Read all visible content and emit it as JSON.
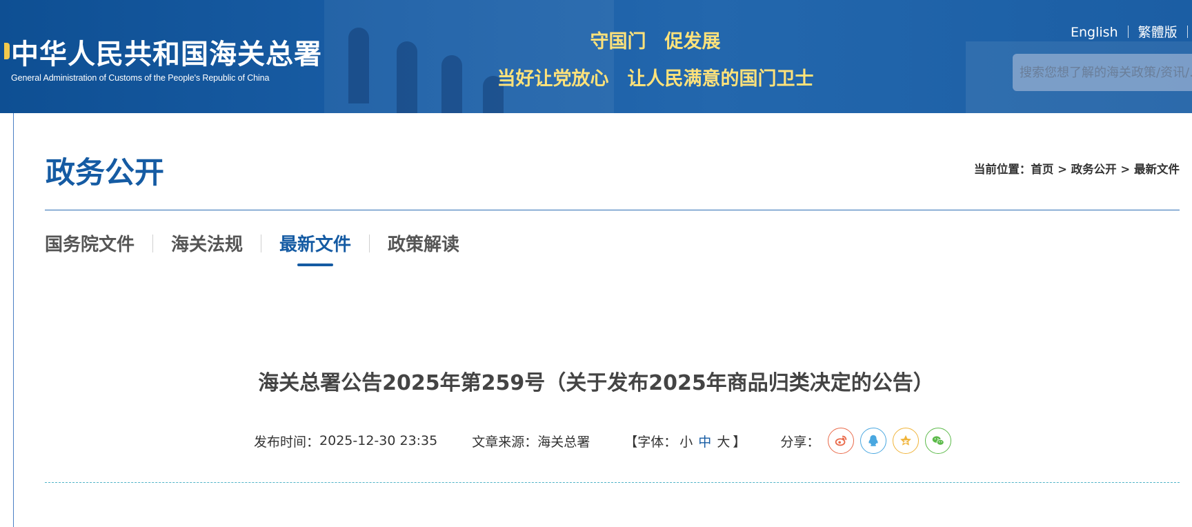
{
  "header": {
    "logo_cn": "中华人民共和国海关总署",
    "logo_en": "General Administration of Customs of the People's Republic of China",
    "slogan_line1": "守国门　促发展",
    "slogan_line2": "当好让党放心　让人民满意的国门卫士",
    "lang_english": "English",
    "lang_traditional": "繁體版",
    "search_placeholder": "搜索您想了解的海关政策/资讯/..."
  },
  "section": {
    "title": "政务公开",
    "breadcrumb_prefix": "当前位置：",
    "breadcrumb": [
      "首页",
      "政务公开",
      "最新文件"
    ],
    "breadcrumb_sep": " > "
  },
  "tabs": [
    {
      "label": "国务院文件",
      "active": false
    },
    {
      "label": "海关法规",
      "active": false
    },
    {
      "label": "最新文件",
      "active": true
    },
    {
      "label": "政策解读",
      "active": false
    }
  ],
  "article": {
    "title": "海关总署公告2025年第259号（关于发布2025年商品归类决定的公告）",
    "publish_label": "发布时间：",
    "publish_time": "2025-12-30 23:35",
    "source_label": "文章来源：",
    "source": "海关总署",
    "font_open": "【字体：",
    "font_small": "小",
    "font_medium": "中",
    "font_large": "大",
    "font_close": "】",
    "share_label": "分享："
  },
  "share_icons": [
    "weibo-icon",
    "qq-icon",
    "qzone-icon",
    "wechat-icon"
  ],
  "colors": {
    "brand_blue": "#155ba3",
    "slogan_gold": "#ffe27a",
    "weibo": "#e96a4a",
    "qq": "#49a7e0",
    "qzone": "#f0b43a",
    "wechat": "#5cba4a"
  }
}
